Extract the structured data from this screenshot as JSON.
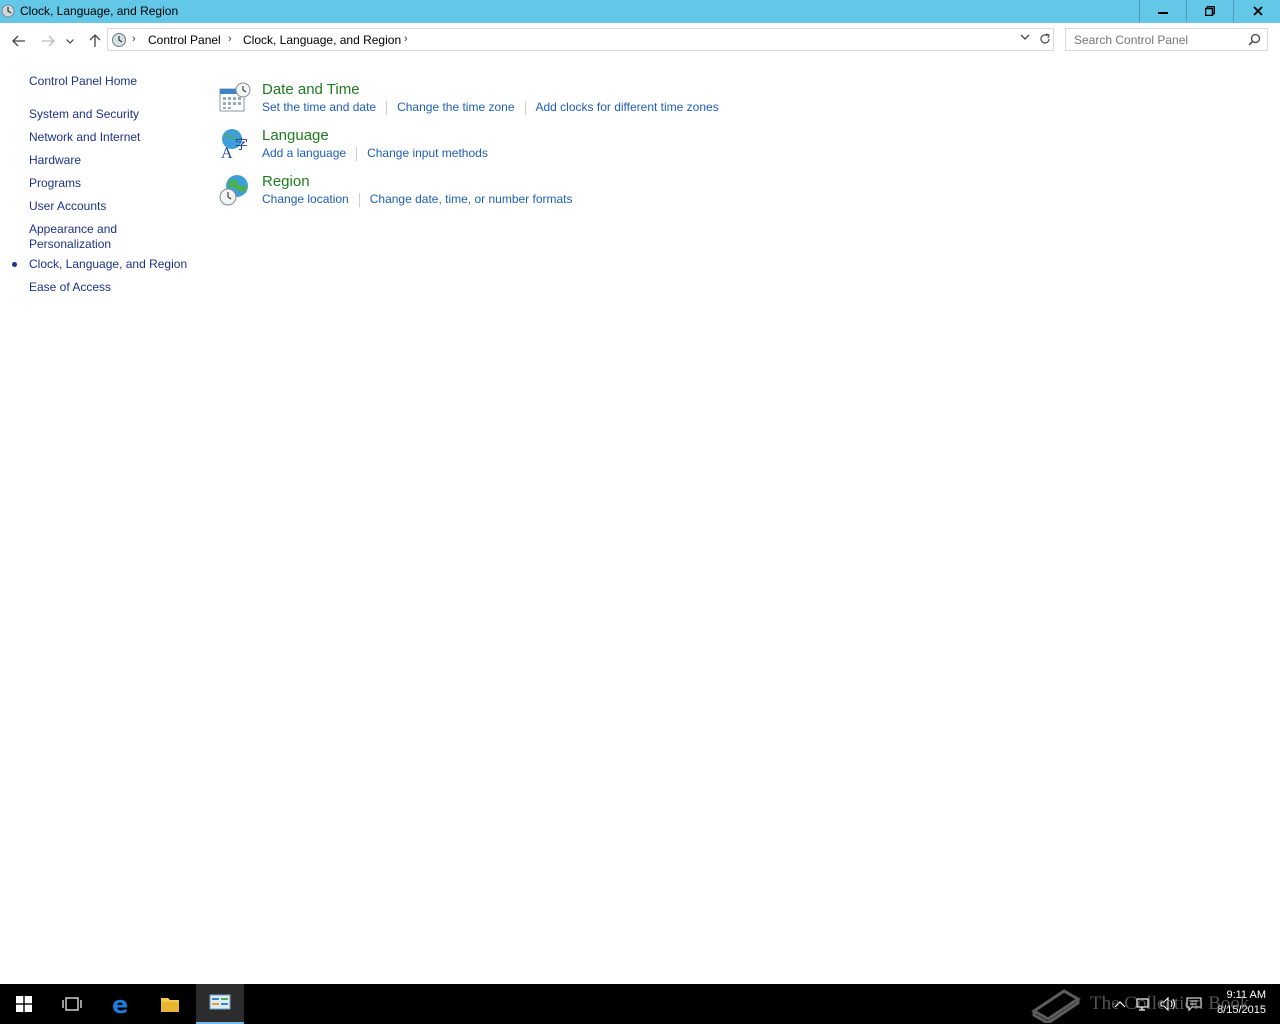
{
  "window": {
    "title": "Clock, Language, and Region",
    "buttons": {
      "minimize": "minimize-icon",
      "restore": "restore-icon",
      "close": "close-icon"
    }
  },
  "address": {
    "breadcrumbs": [
      "Control Panel",
      "Clock, Language, and Region"
    ],
    "search_placeholder": "Search Control Panel"
  },
  "sidebar": {
    "items": [
      {
        "label": "Control Panel Home"
      },
      {
        "label": "System and Security"
      },
      {
        "label": "Network and Internet"
      },
      {
        "label": "Hardware"
      },
      {
        "label": "Programs"
      },
      {
        "label": "User Accounts"
      },
      {
        "label": "Appearance and"
      },
      {
        "label": "Personalization"
      },
      {
        "label": "Clock, Language, and Region",
        "current": true
      },
      {
        "label": "Ease of Access"
      }
    ]
  },
  "categories": [
    {
      "title": "Date and Time",
      "icon": "calendar-clock-icon",
      "links": [
        "Set the time and date",
        "Change the time zone",
        "Add clocks for different time zones"
      ]
    },
    {
      "title": "Language",
      "icon": "language-icon",
      "links": [
        "Add a language",
        "Change input methods"
      ]
    },
    {
      "title": "Region",
      "icon": "globe-clock-icon",
      "links": [
        "Change location",
        "Change date, time, or number formats"
      ]
    }
  ],
  "taskbar": {
    "items": [
      "start-icon",
      "task-view-icon",
      "edge-icon",
      "file-explorer-icon",
      "control-panel-icon"
    ],
    "clock": {
      "time": "9:11 AM",
      "date": "8/15/2015"
    },
    "watermark": "The Collection Book"
  },
  "colors": {
    "titlebar": "#63c7e8",
    "link": "#1e5fb4",
    "category_title": "#1e7b1e",
    "nav_link": "#1e3287"
  }
}
